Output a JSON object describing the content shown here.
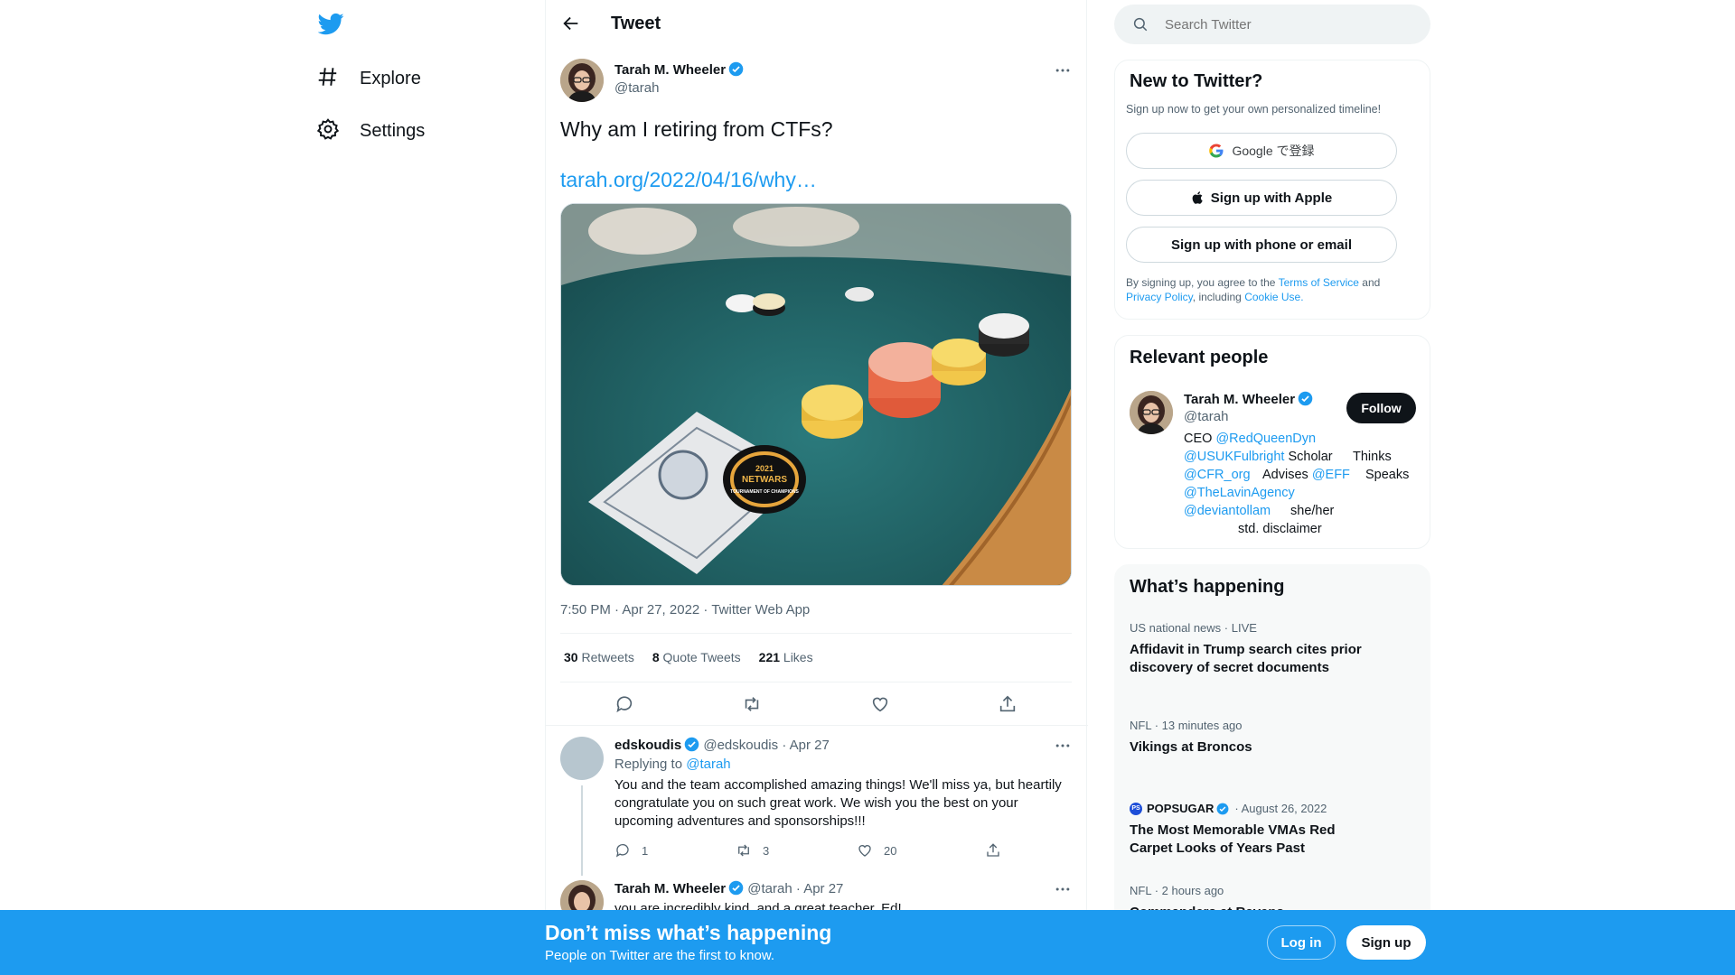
{
  "nav": {
    "logo": "twitter-bird-icon",
    "items": [
      {
        "label": "Explore",
        "icon": "hashtag-icon"
      },
      {
        "label": "Settings",
        "icon": "gear-icon"
      }
    ]
  },
  "header": {
    "title": "Tweet"
  },
  "tweet": {
    "author_name": "Tarah M. Wheeler",
    "author_handle": "@tarah",
    "text": "Why am I retiring from CTFs?",
    "link": "tarah.org/2022/04/16/why…",
    "timestamp": "7:50 PM · Apr 27, 2022 · Twitter Web App",
    "stats": {
      "retweets_count": "30",
      "retweets_label": "Retweets",
      "quotes_count": "8",
      "quotes_label": "Quote Tweets",
      "likes_count": "221",
      "likes_label": "Likes"
    },
    "photo_chip_text": {
      "top": "2021",
      "mid": "NETWARS",
      "bottom": "TOURNAMENT OF CHAMPIONS"
    }
  },
  "replies": [
    {
      "name": "edskoudis",
      "handle": "@edskoudis",
      "date": "· Apr 27",
      "replying_prefix": "Replying to",
      "replying_to": "@tarah",
      "text": "You and the team accomplished amazing things!  We'll miss ya, but heartily congratulate you on such great work. We wish you the best on your upcoming adventures and sponsorships!!!",
      "replies": "1",
      "retweets": "3",
      "likes": "20"
    },
    {
      "name": "Tarah M. Wheeler",
      "handle": "@tarah",
      "date": "· Apr 27",
      "text": "you are incredibly kind, and a great teacher, Ed!"
    }
  ],
  "search": {
    "placeholder": "Search Twitter"
  },
  "signup": {
    "title": "New to Twitter?",
    "subtitle": "Sign up now to get your own personalized timeline!",
    "google_label": "Google で登録",
    "apple_label": "Sign up with Apple",
    "phone_label": "Sign up with phone or email",
    "legal_prefix": "By signing up, you agree to the",
    "terms": "Terms of Service",
    "and": "and",
    "privacy": "Privacy Policy",
    "including": ", including",
    "cookie": "Cookie Use."
  },
  "relevant": {
    "title": "Relevant people",
    "name": "Tarah M. Wheeler",
    "handle": "@tarah",
    "follow_label": "Follow",
    "bio": {
      "ceo": "CEO",
      "redqueen": "@RedQueenDyn",
      "usuk": "@USUKFulbright",
      "scholar": "Scholar",
      "thinks": "Thinks",
      "cfr": "@CFR_org",
      "advises": "Advises",
      "eff": "@EFF",
      "speaks": "Speaks",
      "lavin": "@TheLavinAgency",
      "deviant": "@deviantollam",
      "pronouns": "she/her",
      "disclaimer": "std. disclaimer"
    }
  },
  "happening": {
    "title": "What’s happening",
    "trends": [
      {
        "meta": "US national news · LIVE",
        "title": "Affidavit in Trump search cites prior discovery of secret documents"
      },
      {
        "meta": "NFL · 13 minutes ago",
        "title": "Vikings at Broncos"
      },
      {
        "source": "POPSUGAR",
        "meta": "· August 26, 2022",
        "title": "The Most Memorable VMAs Red Carpet Looks of Years Past"
      },
      {
        "meta": "NFL · 2 hours ago",
        "title": "Commanders at Ravens"
      }
    ]
  },
  "banner": {
    "title": "Don’t miss what’s happening",
    "subtitle": "People on Twitter are the first to know.",
    "login_label": "Log in",
    "signup_label": "Sign up"
  },
  "colors": {
    "accent": "#1d9bf0",
    "text": "#0f1419",
    "muted": "#536471"
  }
}
